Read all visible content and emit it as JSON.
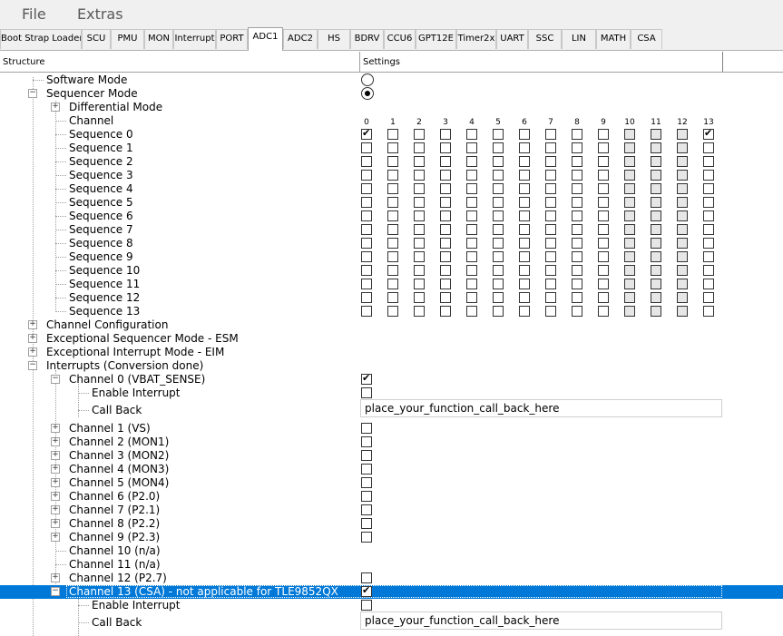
{
  "menu": {
    "file": "File",
    "extras": "Extras"
  },
  "tabs": [
    {
      "label": "Boot Strap Loader",
      "active": false
    },
    {
      "label": "SCU",
      "active": false
    },
    {
      "label": "PMU",
      "active": false
    },
    {
      "label": "MON",
      "active": false
    },
    {
      "label": "Interrupt",
      "active": false
    },
    {
      "label": "PORT",
      "active": false
    },
    {
      "label": "ADC1",
      "active": true
    },
    {
      "label": "ADC2",
      "active": false
    },
    {
      "label": "HS",
      "active": false
    },
    {
      "label": "BDRV",
      "active": false
    },
    {
      "label": "CCU6",
      "active": false
    },
    {
      "label": "GPT12E",
      "active": false
    },
    {
      "label": "Timer2x",
      "active": false
    },
    {
      "label": "UART",
      "active": false
    },
    {
      "label": "SSC",
      "active": false
    },
    {
      "label": "LIN",
      "active": false
    },
    {
      "label": "MATH",
      "active": false
    },
    {
      "label": "CSA",
      "active": false
    }
  ],
  "header": {
    "structure": "Structure",
    "settings": "Settings"
  },
  "colors": {
    "selection": "#0078d7",
    "selection_text": "#ffffff"
  },
  "tree": {
    "software_mode": "Software Mode",
    "sequencer_mode": "Sequencer Mode",
    "differential_mode": "Differential Mode",
    "channel_label": "Channel",
    "channel_numbers": [
      "0",
      "1",
      "2",
      "3",
      "4",
      "5",
      "6",
      "7",
      "8",
      "9",
      "10",
      "11",
      "12",
      "13"
    ],
    "sequences": [
      {
        "label": "Sequence 0",
        "checked": [
          0,
          13
        ]
      },
      {
        "label": "Sequence 1",
        "checked": []
      },
      {
        "label": "Sequence 2",
        "checked": []
      },
      {
        "label": "Sequence 3",
        "checked": []
      },
      {
        "label": "Sequence 4",
        "checked": []
      },
      {
        "label": "Sequence 5",
        "checked": []
      },
      {
        "label": "Sequence 6",
        "checked": []
      },
      {
        "label": "Sequence 7",
        "checked": []
      },
      {
        "label": "Sequence 8",
        "checked": []
      },
      {
        "label": "Sequence 9",
        "checked": []
      },
      {
        "label": "Sequence 10",
        "checked": []
      },
      {
        "label": "Sequence 11",
        "checked": []
      },
      {
        "label": "Sequence 12",
        "checked": []
      },
      {
        "label": "Sequence 13",
        "checked": []
      }
    ],
    "channel_configuration": "Channel Configuration",
    "esm": "Exceptional Sequencer Mode - ESM",
    "eim": "Exceptional Interrupt Mode - EIM",
    "interrupts": "Interrupts (Conversion done)",
    "ch0": "Channel 0 (VBAT_SENSE)",
    "enable_interrupt": "Enable Interrupt",
    "call_back": "Call Back",
    "callback_value": "place_your_function_call_back_here",
    "ch1": "Channel 1 (VS)",
    "ch2": "Channel 2 (MON1)",
    "ch3": "Channel 3 (MON2)",
    "ch4": "Channel 4 (MON3)",
    "ch5": "Channel 5 (MON4)",
    "ch6": "Channel 6 (P2.0)",
    "ch7": "Channel 7 (P2.1)",
    "ch8": "Channel 8 (P2.2)",
    "ch9": "Channel 9 (P2.3)",
    "ch10": "Channel 10 (n/a)",
    "ch11": "Channel 11 (n/a)",
    "ch12": "Channel 12 (P2.7)",
    "ch13": "Channel 13 (CSA) - not applicable for TLE9852QX",
    "enable_interrupt_13": "Enable Interrupt",
    "call_back_13": "Call Back",
    "callback_value_13": "place_your_function_call_back_here"
  },
  "state": {
    "software_mode_selected": false,
    "sequencer_mode_selected": true,
    "ch0_checked": true,
    "ch0_enable_interrupt": false,
    "ch13_checked": true,
    "ch13_enable_interrupt": false,
    "channels_1_to_9_checked": false,
    "ch12_checked": false
  }
}
